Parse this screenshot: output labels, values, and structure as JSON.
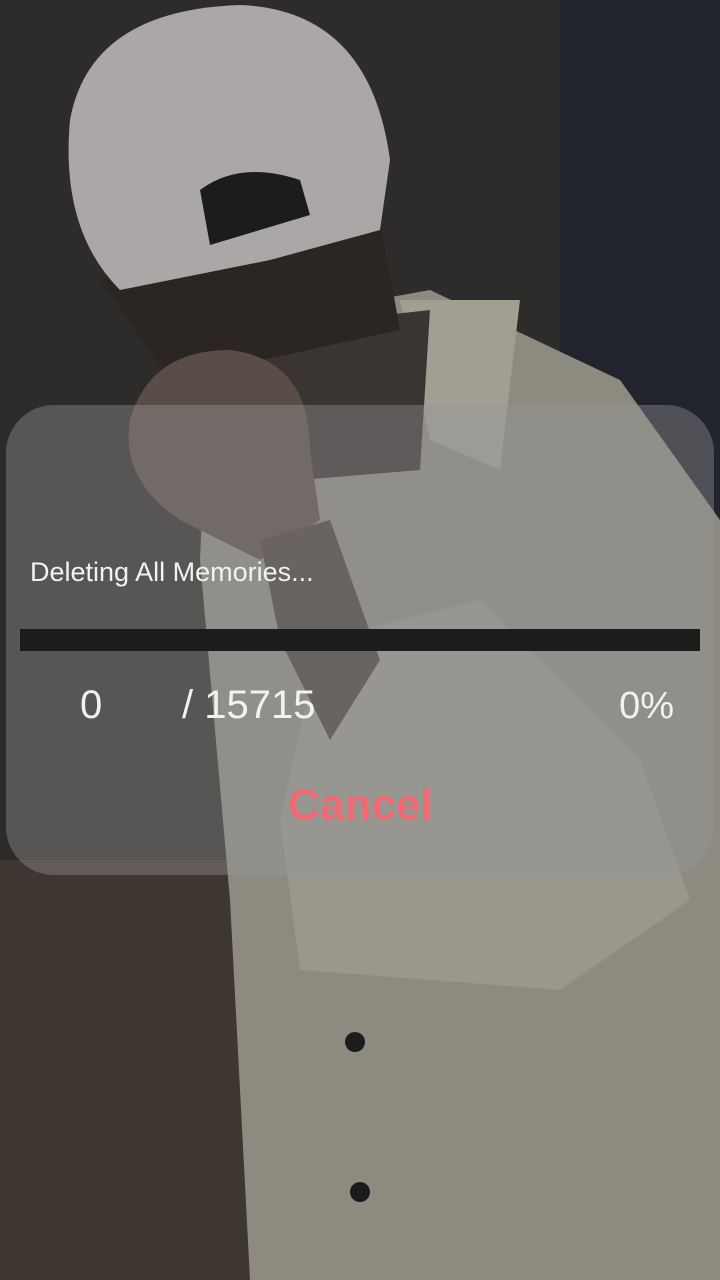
{
  "background": {
    "description_icon": "person-photo-background"
  },
  "dialog": {
    "title": "Deleting All Memories...",
    "progress_fraction": 0,
    "current_count": "0",
    "total_count": "/ 15715",
    "percent": "0%",
    "cancel_label": "Cancel"
  },
  "colors": {
    "cancel": "#ef6b73",
    "text": "#f2f2f2",
    "track": "#1c1c1c"
  }
}
